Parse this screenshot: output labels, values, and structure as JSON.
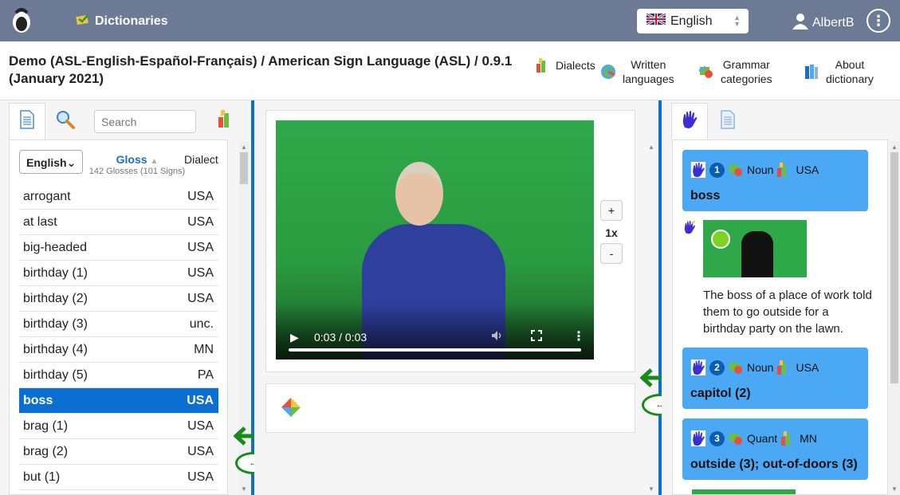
{
  "header": {
    "dictionaries_label": "Dictionaries",
    "language_select": "English",
    "user_name": "AlbertB"
  },
  "titlebar": {
    "title": "Demo (ASL-English-Español-Français) / American Sign Language (ASL) / 0.9.1 (January 2021)",
    "nav": {
      "dialects": "Dialects",
      "written_languages_1": "Written",
      "written_languages_2": "languages",
      "grammar_1": "Grammar",
      "grammar_2": "categories",
      "about_1": "About",
      "about_2": "dictionary"
    }
  },
  "left": {
    "search_placeholder": "Search",
    "language_dropdown": "English",
    "gloss_header": "Gloss",
    "gloss_count": "142 Glosses (101 Signs)",
    "dialect_header": "Dialect",
    "rows": [
      {
        "gloss": "arrogant",
        "dialect": "USA"
      },
      {
        "gloss": "at last",
        "dialect": "USA"
      },
      {
        "gloss": "big-headed",
        "dialect": "USA"
      },
      {
        "gloss": "birthday (1)",
        "dialect": "USA"
      },
      {
        "gloss": "birthday (2)",
        "dialect": "USA"
      },
      {
        "gloss": "birthday (3)",
        "dialect": "unc."
      },
      {
        "gloss": "birthday (4)",
        "dialect": "MN"
      },
      {
        "gloss": "birthday (5)",
        "dialect": "PA"
      },
      {
        "gloss": "boss",
        "dialect": "USA",
        "selected": true
      },
      {
        "gloss": "brag (1)",
        "dialect": "USA"
      },
      {
        "gloss": "brag (2)",
        "dialect": "USA"
      },
      {
        "gloss": "but (1)",
        "dialect": "USA"
      }
    ]
  },
  "video": {
    "time": "0:03 / 0:03",
    "speed_plus": "+",
    "speed_label": "1x",
    "speed_minus": "-"
  },
  "right": {
    "senses": [
      {
        "number": "1",
        "category": "Noun",
        "dialect": "USA",
        "word": "boss"
      },
      {
        "number": "2",
        "category": "Noun",
        "dialect": "USA",
        "word": "capitol (2)"
      },
      {
        "number": "3",
        "category": "Quant",
        "dialect": "MN",
        "word": "outside (3); out-of-doors (3)"
      }
    ],
    "example_text": "The boss of a place of work told them to go outside for a birthday party on the lawn."
  },
  "colors": {
    "topbar": "#6c7a96",
    "accent": "#0b6fd1",
    "sense_card": "#4aa8f5",
    "resize_handle": "#168a1b"
  }
}
